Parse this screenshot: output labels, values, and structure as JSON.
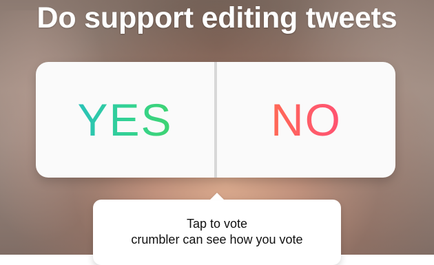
{
  "story": {
    "title": "Do support editing tweets"
  },
  "poll": {
    "options": [
      {
        "label": "YES"
      },
      {
        "label": "NO"
      }
    ]
  },
  "tooltip": {
    "line1": "Tap to vote",
    "line2": "crumbler can see how you vote"
  }
}
